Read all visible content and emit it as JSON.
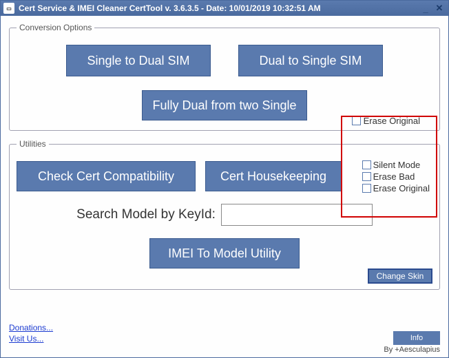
{
  "window": {
    "title": "Cert Service & IMEI Cleaner CertTool v. 3.6.3.5 - Date: 10/01/2019 10:32:51 AM"
  },
  "conversion": {
    "legend": "Conversion Options",
    "single_to_dual": "Single to Dual SIM",
    "dual_to_single": "Dual to Single SIM",
    "fully_dual": "Fully Dual from two Single",
    "erase_original": "Erase Original"
  },
  "utilities": {
    "legend": "Utilities",
    "check_compat": "Check Cert Compatibility",
    "housekeeping": "Cert Housekeeping",
    "silent_mode": "Silent Mode",
    "erase_bad": "Erase Bad",
    "erase_original": "Erase Original",
    "search_label": "Search Model by KeyId:",
    "search_value": "",
    "imei_to_model": "IMEI To Model Utility",
    "change_skin": "Change Skin"
  },
  "footer": {
    "donations": "Donations...",
    "visit": "Visit Us...",
    "info": "Info",
    "credit": "By +Aesculapius"
  }
}
